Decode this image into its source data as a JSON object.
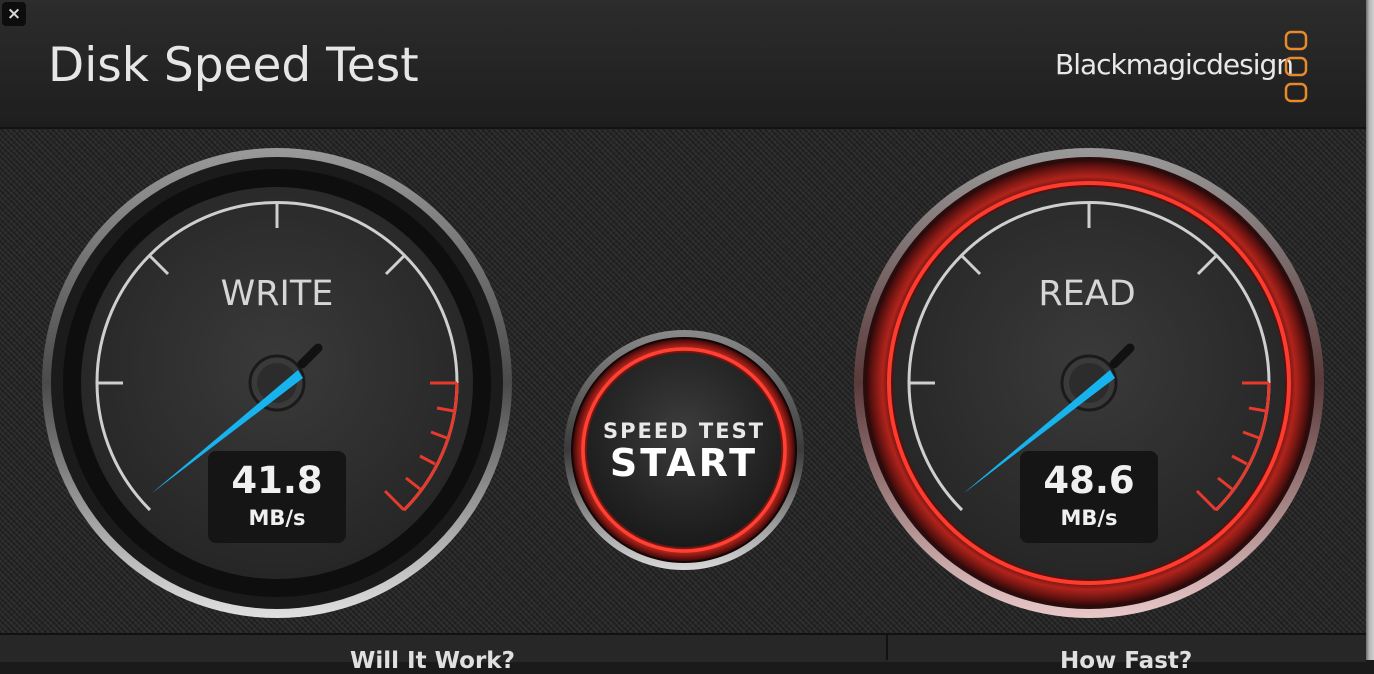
{
  "window": {
    "title": "Disk Speed Test",
    "brand": "Blackmagicdesign",
    "close_symbol": "×"
  },
  "settings": {
    "icon": "gear-icon"
  },
  "write_gauge": {
    "label": "WRITE",
    "value": "41.8",
    "unit": "MB/s"
  },
  "read_gauge": {
    "label": "READ",
    "value": "48.6",
    "unit": "MB/s"
  },
  "start_button": {
    "line1": "SPEED TEST",
    "line2": "START"
  },
  "footer": {
    "tab_left": "Will It Work?",
    "tab_right": "How Fast?"
  },
  "colors": {
    "needle": "#16b3ee",
    "accent_red": "#e8392d",
    "logo_orange": "#e8892a"
  }
}
